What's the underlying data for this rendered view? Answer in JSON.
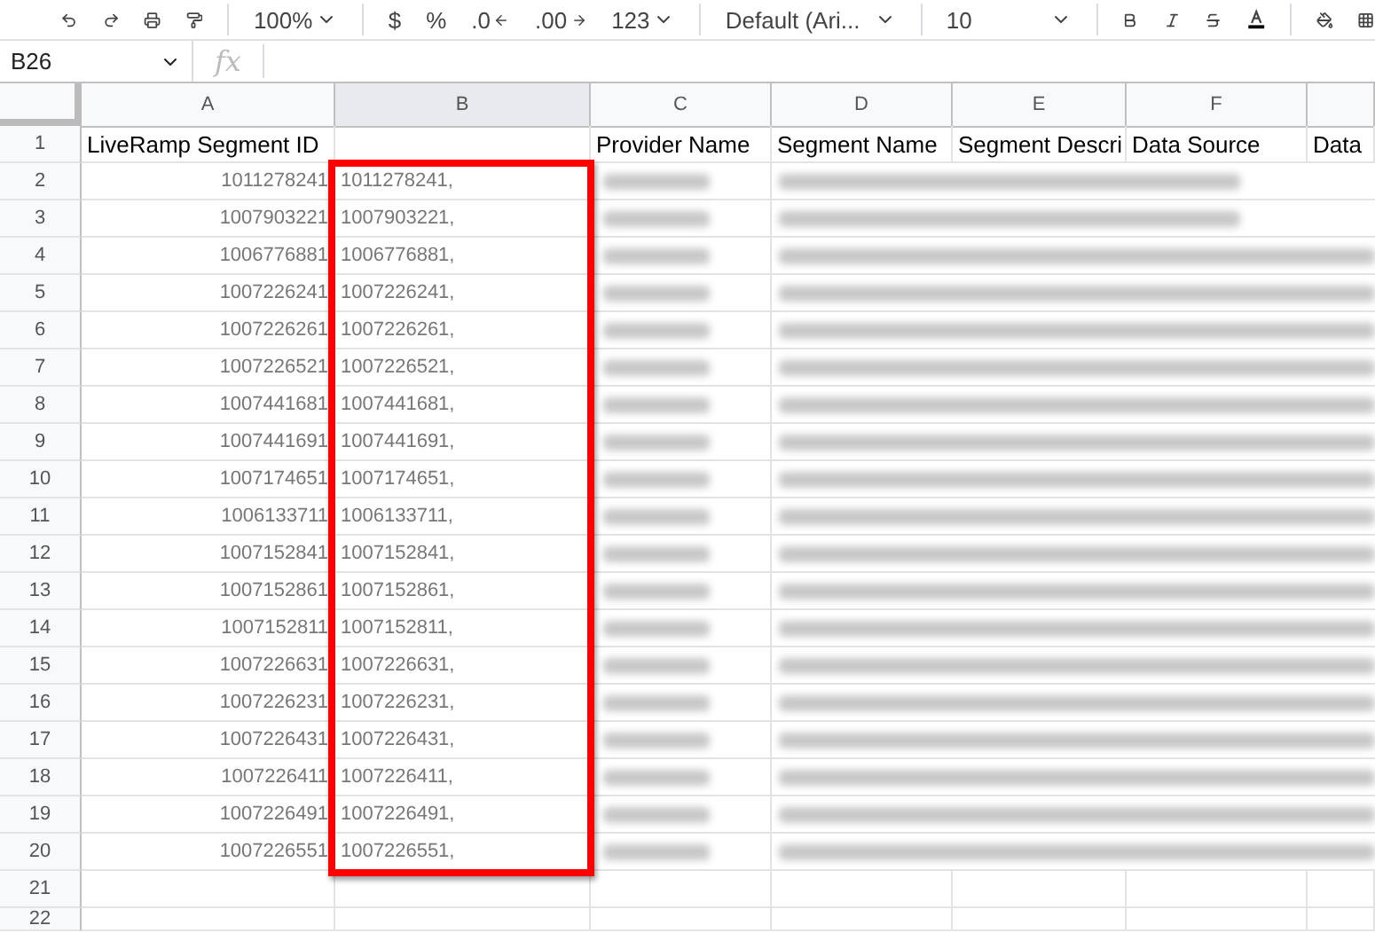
{
  "toolbar": {
    "zoom": "100%",
    "currency": "$",
    "percent": "%",
    "decrease_decimals": ".0",
    "increase_decimals": ".00",
    "number_format": "123",
    "font": "Default (Ari...",
    "font_size": "10"
  },
  "formula_bar": {
    "name_box": "B26",
    "fx": "fx"
  },
  "columns": [
    {
      "label": "A",
      "selected": false
    },
    {
      "label": "B",
      "selected": true
    },
    {
      "label": "C",
      "selected": false
    },
    {
      "label": "D",
      "selected": false
    },
    {
      "label": "E",
      "selected": false
    },
    {
      "label": "F",
      "selected": false
    }
  ],
  "header_row": {
    "number": "1",
    "cells": [
      "LiveRamp Segment ID",
      "",
      "Provider Name",
      "Segment Name",
      "Segment Descri",
      "Data Source",
      "Data"
    ]
  },
  "rows": [
    {
      "number": "2",
      "segment_id": "1011278241",
      "column_b": "1011278241,"
    },
    {
      "number": "3",
      "segment_id": "1007903221",
      "column_b": "1007903221,"
    },
    {
      "number": "4",
      "segment_id": "1006776881",
      "column_b": "1006776881,"
    },
    {
      "number": "5",
      "segment_id": "1007226241",
      "column_b": "1007226241,"
    },
    {
      "number": "6",
      "segment_id": "1007226261",
      "column_b": "1007226261,"
    },
    {
      "number": "7",
      "segment_id": "1007226521",
      "column_b": "1007226521,"
    },
    {
      "number": "8",
      "segment_id": "1007441681",
      "column_b": "1007441681,"
    },
    {
      "number": "9",
      "segment_id": "1007441691",
      "column_b": "1007441691,"
    },
    {
      "number": "10",
      "segment_id": "1007174651",
      "column_b": "1007174651,"
    },
    {
      "number": "11",
      "segment_id": "1006133711",
      "column_b": "1006133711,"
    },
    {
      "number": "12",
      "segment_id": "1007152841",
      "column_b": "1007152841,"
    },
    {
      "number": "13",
      "segment_id": "1007152861",
      "column_b": "1007152861,"
    },
    {
      "number": "14",
      "segment_id": "1007152811",
      "column_b": "1007152811,"
    },
    {
      "number": "15",
      "segment_id": "1007226631",
      "column_b": "1007226631,"
    },
    {
      "number": "16",
      "segment_id": "1007226231",
      "column_b": "1007226231,"
    },
    {
      "number": "17",
      "segment_id": "1007226431",
      "column_b": "1007226431,"
    },
    {
      "number": "18",
      "segment_id": "1007226411",
      "column_b": "1007226411,"
    },
    {
      "number": "19",
      "segment_id": "1007226491",
      "column_b": "1007226491,"
    },
    {
      "number": "20",
      "segment_id": "1007226551",
      "column_b": "1007226551,"
    }
  ],
  "empty_rows": [
    "21",
    "22"
  ]
}
